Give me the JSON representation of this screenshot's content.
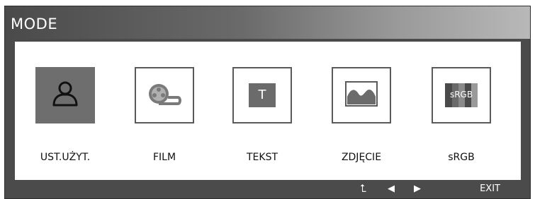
{
  "window": {
    "title": "MODE"
  },
  "modes": [
    {
      "label": "UST.UŻYT.",
      "icon": "user-icon",
      "selected": true
    },
    {
      "label": "FILM",
      "icon": "film-reel-icon",
      "selected": false
    },
    {
      "label": "TEKST",
      "icon": "text-icon",
      "icon_text": "T",
      "selected": false
    },
    {
      "label": "ZDJĘCIE",
      "icon": "photo-icon",
      "selected": false
    },
    {
      "label": "sRGB",
      "icon": "srgb-icon",
      "icon_text": "sRGB",
      "selected": false
    }
  ],
  "nav": {
    "up_symbol": "⮤",
    "left_symbol": "◀",
    "right_symbol": "▶",
    "exit_label": "EXIT"
  },
  "colors": {
    "frame": "#4b4b4b",
    "selected_tile": "#6e6e6e",
    "panel": "#ffffff"
  }
}
